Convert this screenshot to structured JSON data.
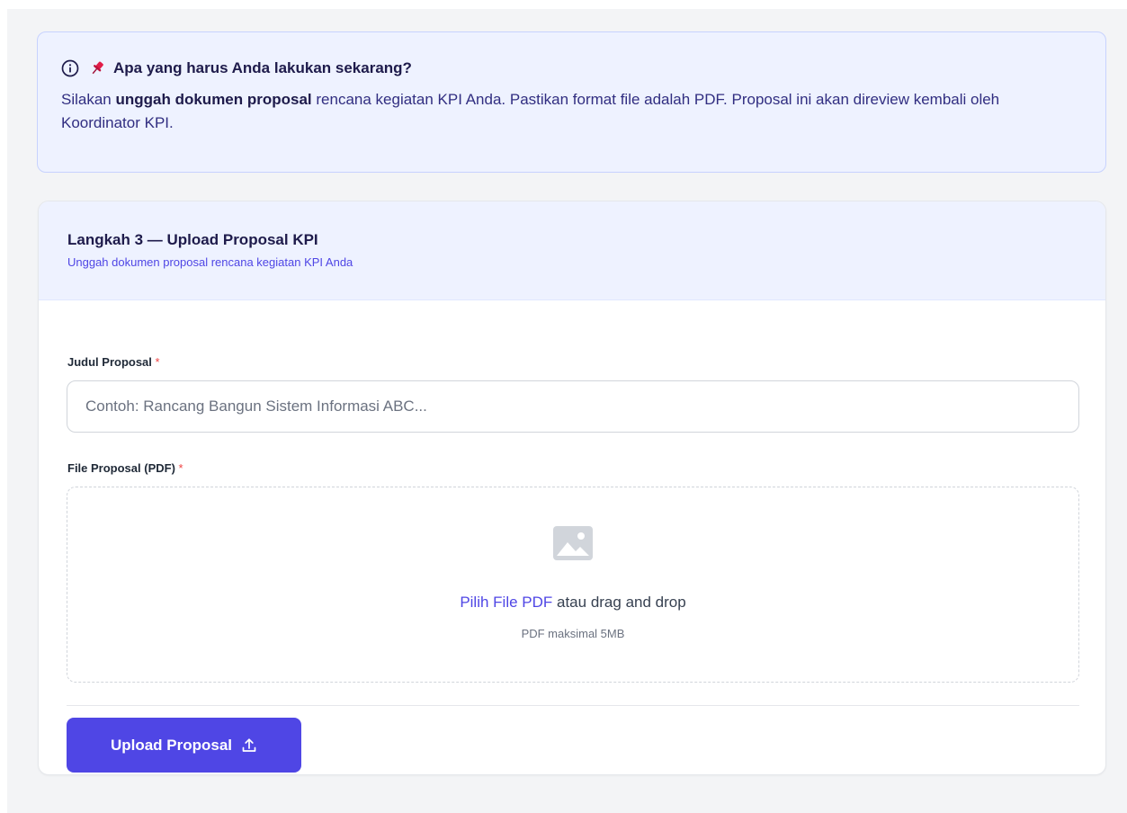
{
  "banner": {
    "title": "Apa yang harus Anda lakukan sekarang?",
    "body_prefix": "Silakan ",
    "body_strong": "unggah dokumen proposal",
    "body_suffix": " rencana kegiatan KPI Anda. Pastikan format file adalah PDF. Proposal ini akan direview kembali oleh Koordinator KPI.",
    "info_icon": "info-circle-icon",
    "pin_icon": "pushpin-icon"
  },
  "card": {
    "title": "Langkah 3 — Upload Proposal KPI",
    "subtitle": "Unggah dokumen proposal rencana kegiatan KPI Anda"
  },
  "form": {
    "title_label": "Judul Proposal",
    "title_placeholder": "Contoh: Rancang Bangun Sistem Informasi ABC...",
    "title_value": "",
    "required_mark": "*",
    "file_label": "File Proposal (PDF)",
    "dropzone": {
      "icon": "image-icon",
      "choose_link": "Pilih File PDF",
      "drop_text": " atau drag and drop",
      "hint": "PDF maksimal 5MB"
    },
    "submit_label": "Upload Proposal",
    "submit_icon": "upload-icon"
  },
  "colors": {
    "accent": "#4f46e5",
    "banner_bg": "#eef2ff",
    "required": "#ef4444"
  }
}
